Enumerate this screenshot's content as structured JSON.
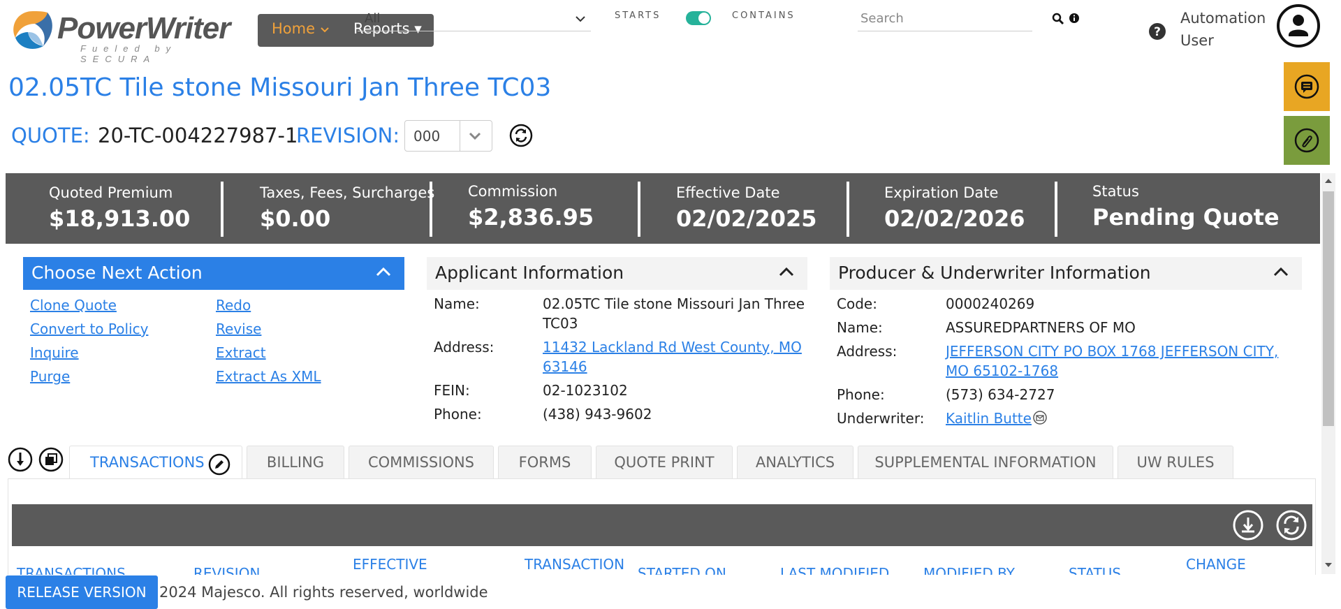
{
  "header": {
    "logo_text": "PowerWriter",
    "logo_tagline": "Fueled by SECURA",
    "nav": {
      "home": "Home",
      "reports": "Reports"
    },
    "scope_select": "All",
    "starts_label": "STARTS",
    "contains_label": "CONTAINS",
    "search_placeholder": "Search",
    "user_line1": "Automation",
    "user_line2": "User"
  },
  "page": {
    "title": "02.05TC Tile stone Missouri Jan Three TC03",
    "quote_label": "QUOTE:",
    "quote_number": "20-TC-004227987-1",
    "revision_label": "REVISION:",
    "revision_value": "000"
  },
  "summary": [
    {
      "label": "Quoted Premium",
      "value": "$18,913.00"
    },
    {
      "label": "Taxes, Fees, Surcharges",
      "value": "$0.00"
    },
    {
      "label": "Commission",
      "value": "$2,836.95"
    },
    {
      "label": "Effective Date",
      "value": "02/02/2025"
    },
    {
      "label": "Expiration Date",
      "value": "02/02/2026"
    },
    {
      "label": "Status",
      "value": "Pending Quote"
    }
  ],
  "next_action": {
    "title": "Choose Next Action",
    "left": [
      "Clone Quote",
      "Convert to Policy",
      "Inquire",
      "Purge"
    ],
    "right": [
      "Redo",
      "Revise",
      "Extract",
      "Extract As XML"
    ]
  },
  "applicant": {
    "title": "Applicant Information",
    "name_label": "Name:",
    "name": "02.05TC Tile stone Missouri Jan Three TC03",
    "address_label": "Address:",
    "address": "11432 Lackland Rd West County, MO 63146",
    "fein_label": "FEIN:",
    "fein": "02-1023102",
    "phone_label": "Phone:",
    "phone": "(438) 943-9602"
  },
  "producer": {
    "title": "Producer & Underwriter Information",
    "code_label": "Code:",
    "code": "0000240269",
    "name_label": "Name:",
    "name": "ASSUREDPARTNERS OF MO",
    "address_label": "Address:",
    "address": "JEFFERSON CITY PO BOX 1768 JEFFERSON CITY, MO 65102-1768",
    "phone_label": "Phone:",
    "phone": "(573) 634-2727",
    "underwriter_label": "Underwriter:",
    "underwriter": "Kaitlin Butte"
  },
  "tabs": [
    "TRANSACTIONS",
    "BILLING",
    "COMMISSIONS",
    "FORMS",
    "QUOTE PRINT",
    "ANALYTICS",
    "SUPPLEMENTAL INFORMATION",
    "UW RULES"
  ],
  "grid_columns": [
    "TRANSACTIONS",
    "REVISION",
    "EFFECTIVE",
    "TRANSACTION",
    "STARTED ON",
    "LAST MODIFIED",
    "MODIFIED BY",
    "STATUS",
    "CHANGE"
  ],
  "footer": {
    "release_button": "RELEASE VERSION",
    "copyright": "2024 Majesco. All rights reserved, worldwide"
  },
  "colors": {
    "accent": "#2b80e6",
    "band": "#5a5a5a",
    "nav_home": "#f0a13a",
    "toggle": "#26b29a",
    "chat_btn": "#e8a623",
    "attach_btn": "#7a9c3d"
  }
}
